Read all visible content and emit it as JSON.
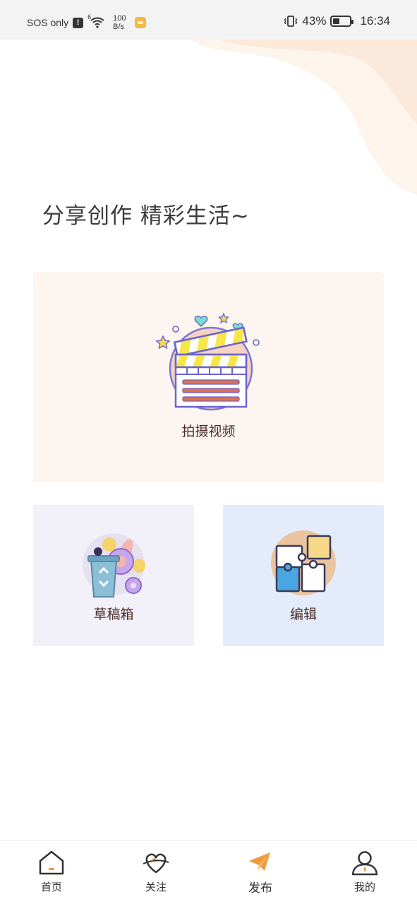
{
  "status_bar": {
    "carrier": "SOS only",
    "alert_glyph": "!",
    "network": "6",
    "speed_value": "100",
    "speed_unit": "B/s",
    "battery_percent": "43%",
    "battery_level": 0.43,
    "time": "16:34"
  },
  "headline": "分享创作 精彩生活~",
  "cards": {
    "shoot": {
      "label": "拍摄视频",
      "icon": "clapperboard-icon"
    },
    "draft": {
      "label": "草稿箱",
      "icon": "recycle-bin-icon"
    },
    "edit": {
      "label": "编辑",
      "icon": "puzzle-icon"
    }
  },
  "bottom_nav": {
    "home": {
      "label": "首页",
      "icon": "home-icon"
    },
    "follow": {
      "label": "关注",
      "icon": "heart-icon"
    },
    "publish": {
      "label": "发布",
      "icon": "paper-plane-icon",
      "active": true
    },
    "mine": {
      "label": "我的",
      "icon": "user-icon"
    }
  },
  "colors": {
    "accent": "#f29a3c",
    "deco_blob": "#fbeee2",
    "shoot_card_bg": "#fdf5ef",
    "draft_card_bg": "#f2f0f8",
    "edit_card_bg": "#e4ecfb"
  }
}
